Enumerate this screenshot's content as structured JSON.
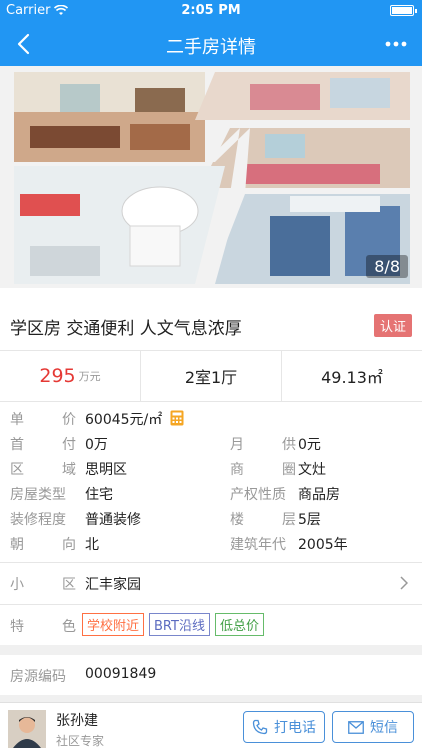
{
  "status_bar": {
    "carrier": "Carrier",
    "time": "2:05 PM"
  },
  "nav": {
    "title": "二手房详情",
    "back_icon": "chevron-left-icon",
    "more_icon": "more-dots-icon"
  },
  "gallery": {
    "counter": "8/8"
  },
  "listing": {
    "headline": "学区房 交通便利 人文气息浓厚",
    "badge": "认证"
  },
  "summary": {
    "price": "295",
    "price_unit": "万元",
    "layout": "2室1厅",
    "area": "49.13㎡"
  },
  "details": {
    "unit_price_label": [
      "单",
      "价"
    ],
    "unit_price": "60045元/㎡",
    "down_payment_label": [
      "首",
      "付"
    ],
    "down_payment": "0万",
    "monthly_label": [
      "月",
      "供"
    ],
    "monthly": "0元",
    "district_label": [
      "区",
      "域"
    ],
    "district": "思明区",
    "business_area_label": [
      "商",
      "圈"
    ],
    "business_area": "文灶",
    "house_type_label": "房屋类型",
    "house_type": "住宅",
    "property_right_label": "产权性质",
    "property_right": "商品房",
    "decoration_label": "装修程度",
    "decoration": "普通装修",
    "floor_label": [
      "楼",
      "层"
    ],
    "floor": "5层",
    "orientation_label": [
      "朝",
      "向"
    ],
    "orientation": "北",
    "build_year_label": "建筑年代",
    "build_year": "2005年"
  },
  "community": {
    "label": [
      "小",
      "区"
    ],
    "name": "汇丰家园"
  },
  "features": {
    "label": [
      "特",
      "色"
    ],
    "tags": [
      "学校附近",
      "BRT沿线",
      "低总价"
    ]
  },
  "listing_code": {
    "label": "房源编码",
    "code": "00091849"
  },
  "agent": {
    "name": "张孙建",
    "role": "社区专家",
    "call_label": "打电话",
    "sms_label": "短信"
  },
  "colors": {
    "primary": "#2196f3",
    "price": "#e53935",
    "badge": "#e57373",
    "button": "#4a90d9"
  }
}
